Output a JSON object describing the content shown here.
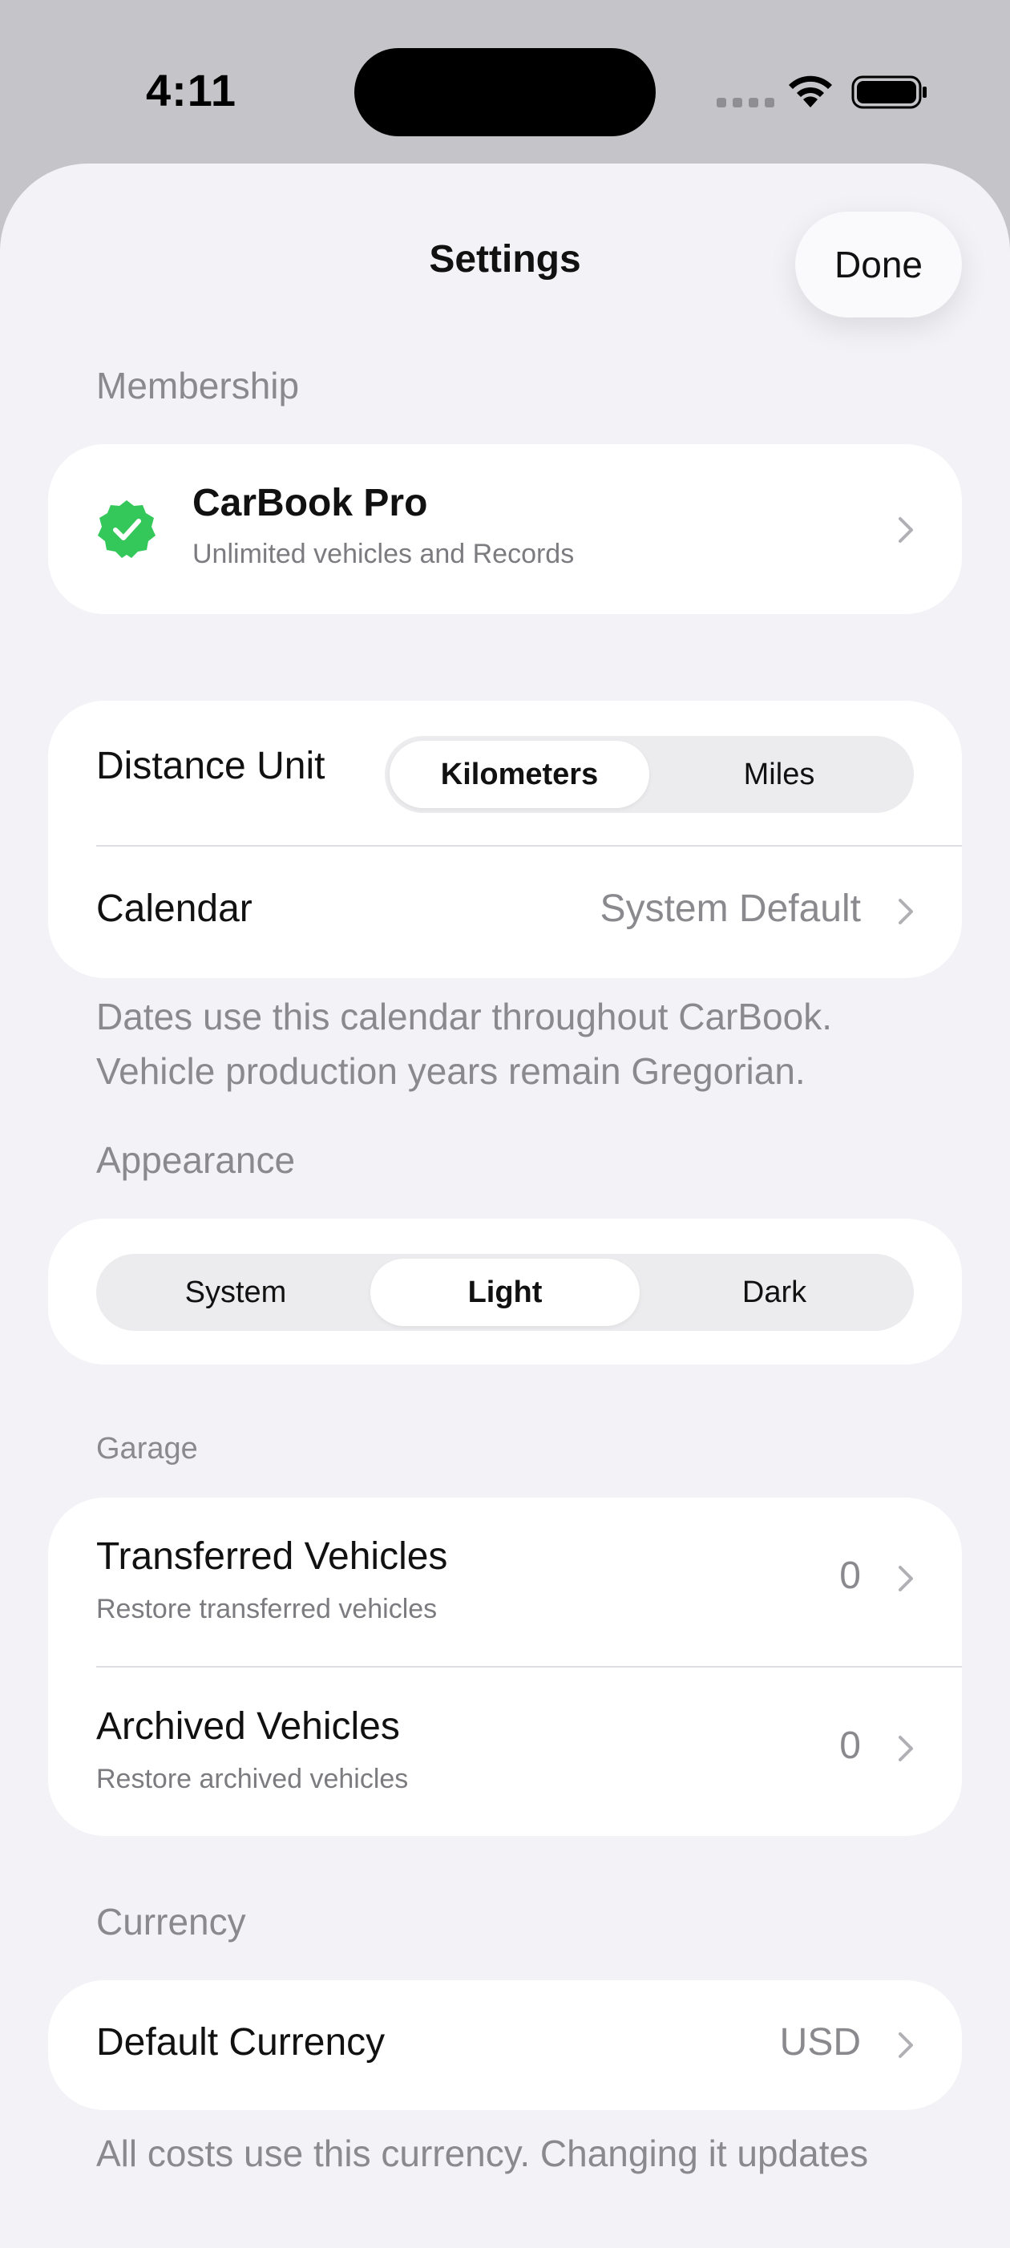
{
  "status_bar": {
    "time": "4:11"
  },
  "header": {
    "title": "Settings",
    "done_label": "Done"
  },
  "membership": {
    "section_label": "Membership",
    "plan_name": "CarBook Pro",
    "plan_description": "Unlimited vehicles and Records",
    "badge_color": "#34c759"
  },
  "units": {
    "distance_label": "Distance Unit",
    "distance_options": [
      "Kilometers",
      "Miles"
    ],
    "distance_selected": "Kilometers",
    "calendar_label": "Calendar",
    "calendar_value": "System Default",
    "calendar_footnote": "Dates use this calendar throughout CarBook. Vehicle production years remain Gregorian."
  },
  "appearance": {
    "section_label": "Appearance",
    "options": [
      "System",
      "Light",
      "Dark"
    ],
    "selected": "Light"
  },
  "garage": {
    "section_label": "Garage",
    "items": [
      {
        "title": "Transferred Vehicles",
        "subtitle": "Restore transferred vehicles",
        "count": "0"
      },
      {
        "title": "Archived Vehicles",
        "subtitle": "Restore archived vehicles",
        "count": "0"
      }
    ]
  },
  "currency": {
    "section_label": "Currency",
    "default_label": "Default Currency",
    "default_value": "USD",
    "footnote": "All costs use this currency. Changing it updates"
  }
}
